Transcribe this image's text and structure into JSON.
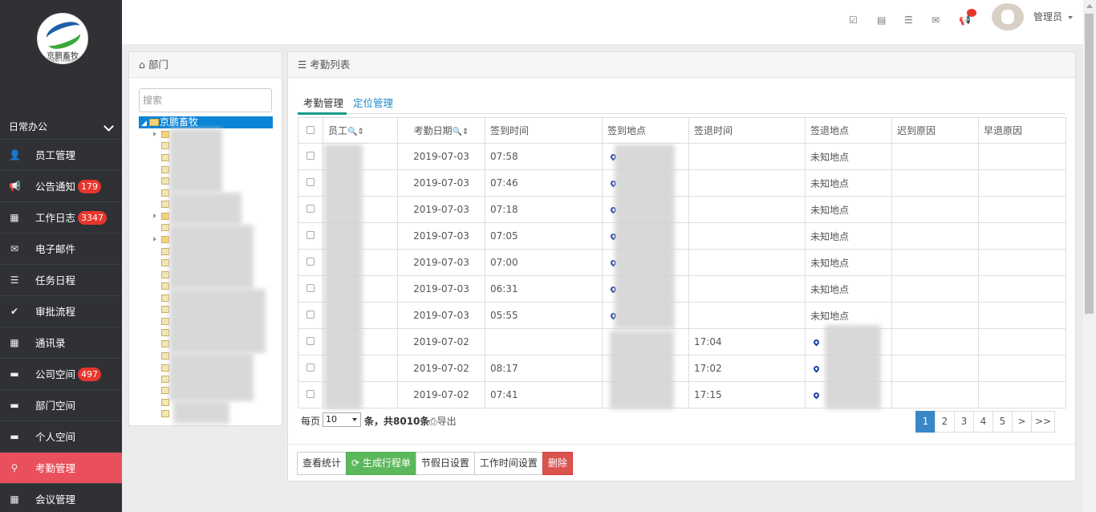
{
  "app": {
    "logo_text": "京鹏畜牧",
    "logo_sub": "JINGPENG HUSBANDRY"
  },
  "sidebar": {
    "group_label": "日常办公",
    "items": [
      {
        "label": "员工管理",
        "icon": "user-icon",
        "badge": ""
      },
      {
        "label": "公告通知",
        "icon": "bullhorn-icon",
        "badge": "179"
      },
      {
        "label": "工作日志",
        "icon": "calendar-icon",
        "badge": "3347"
      },
      {
        "label": "电子邮件",
        "icon": "envelope-icon",
        "badge": ""
      },
      {
        "label": "任务日程",
        "icon": "tasks-icon",
        "badge": ""
      },
      {
        "label": "审批流程",
        "icon": "check-circle-icon",
        "badge": ""
      },
      {
        "label": "通讯录",
        "icon": "grid-icon",
        "badge": ""
      },
      {
        "label": "公司空间",
        "icon": "comment-icon",
        "badge": "497"
      },
      {
        "label": "部门空间",
        "icon": "comment-icon",
        "badge": ""
      },
      {
        "label": "个人空间",
        "icon": "comment-icon",
        "badge": ""
      },
      {
        "label": "考勤管理",
        "icon": "map-marker-icon",
        "badge": "",
        "active": true
      },
      {
        "label": "会议管理",
        "icon": "grid-icon",
        "badge": ""
      }
    ]
  },
  "topbar": {
    "user_name": "管理员"
  },
  "dept_panel": {
    "title": "部门",
    "search_placeholder": "搜索",
    "root_label": "京鹏畜牧"
  },
  "att_panel": {
    "title": "考勤列表",
    "tabs": [
      "考勤管理",
      "定位管理"
    ],
    "columns": [
      "员工",
      "考勤日期",
      "签到时间",
      "签到地点",
      "签退时间",
      "签退地点",
      "迟到原因",
      "早退原因"
    ],
    "rows": [
      {
        "date": "2019-07-03",
        "in_time": "07:58",
        "in_pin": true,
        "out_time": "",
        "out_loc": "未知地点",
        "out_pin": false
      },
      {
        "date": "2019-07-03",
        "in_time": "07:46",
        "in_pin": true,
        "out_time": "",
        "out_loc": "未知地点",
        "out_pin": false
      },
      {
        "date": "2019-07-03",
        "in_time": "07:18",
        "in_pin": true,
        "out_time": "",
        "out_loc": "未知地点",
        "out_pin": false
      },
      {
        "date": "2019-07-03",
        "in_time": "07:05",
        "in_pin": true,
        "out_time": "",
        "out_loc": "未知地点",
        "out_pin": false
      },
      {
        "date": "2019-07-03",
        "in_time": "07:00",
        "in_pin": true,
        "out_time": "",
        "out_loc": "未知地点",
        "out_pin": false
      },
      {
        "date": "2019-07-03",
        "in_time": "06:31",
        "in_pin": true,
        "out_time": "",
        "out_loc": "未知地点",
        "out_pin": false
      },
      {
        "date": "2019-07-03",
        "in_time": "05:55",
        "in_pin": true,
        "out_time": "",
        "out_loc": "未知地点",
        "out_pin": false
      },
      {
        "date": "2019-07-02",
        "in_time": "",
        "in_pin": false,
        "out_time": "17:04",
        "out_loc": "",
        "out_pin": true
      },
      {
        "date": "2019-07-02",
        "in_time": "08:17",
        "in_pin": false,
        "out_time": "17:02",
        "out_loc": "",
        "out_pin": true
      },
      {
        "date": "2019-07-02",
        "in_time": "07:41",
        "in_pin": false,
        "out_time": "17:15",
        "out_loc": "",
        "out_pin": true
      }
    ],
    "per_page_label": "每页",
    "per_page_value": "10",
    "total_label": "条，共8010条",
    "export_label": "导出",
    "pages": [
      "1",
      "2",
      "3",
      "4",
      "5",
      ">",
      ">>"
    ],
    "current_page": "1",
    "buttons": [
      "查看统计",
      "生成行程单",
      "节假日设置",
      "工作时间设置",
      "删除"
    ]
  }
}
